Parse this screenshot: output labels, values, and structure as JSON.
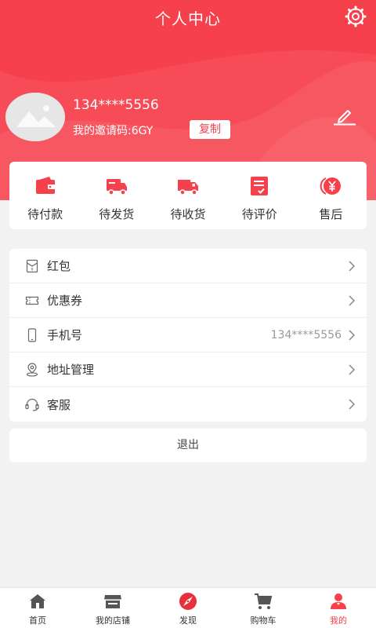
{
  "header": {
    "title": "个人中心"
  },
  "profile": {
    "phone": "134****5556",
    "invite_code": "我的邀请码:6GY",
    "copy_label": "复制"
  },
  "orders": [
    {
      "label": "待付款",
      "icon": "wallet-icon"
    },
    {
      "label": "待发货",
      "icon": "truck-icon"
    },
    {
      "label": "待收货",
      "icon": "delivery-truck-icon"
    },
    {
      "label": "待评价",
      "icon": "review-icon"
    },
    {
      "label": "售后",
      "icon": "yuan-coin-icon"
    }
  ],
  "menu": [
    {
      "label": "红包",
      "value": "",
      "icon": "red-envelope-icon"
    },
    {
      "label": "优惠券",
      "value": "",
      "icon": "coupon-icon"
    },
    {
      "label": "手机号",
      "value": "134****5556",
      "icon": "mobile-phone-icon"
    },
    {
      "label": "地址管理",
      "value": "",
      "icon": "location-pin-icon"
    },
    {
      "label": "客服",
      "value": "",
      "icon": "headset-icon"
    }
  ],
  "logout_label": "退出",
  "tabs": [
    {
      "label": "首页",
      "icon": "home-icon"
    },
    {
      "label": "我的店铺",
      "icon": "store-icon"
    },
    {
      "label": "发现",
      "icon": "compass-icon"
    },
    {
      "label": "购物车",
      "icon": "cart-icon"
    },
    {
      "label": "我的",
      "icon": "user-icon",
      "active": true
    }
  ],
  "colors": {
    "brand_red": "#f6414c",
    "background": "#f2f2f2"
  }
}
